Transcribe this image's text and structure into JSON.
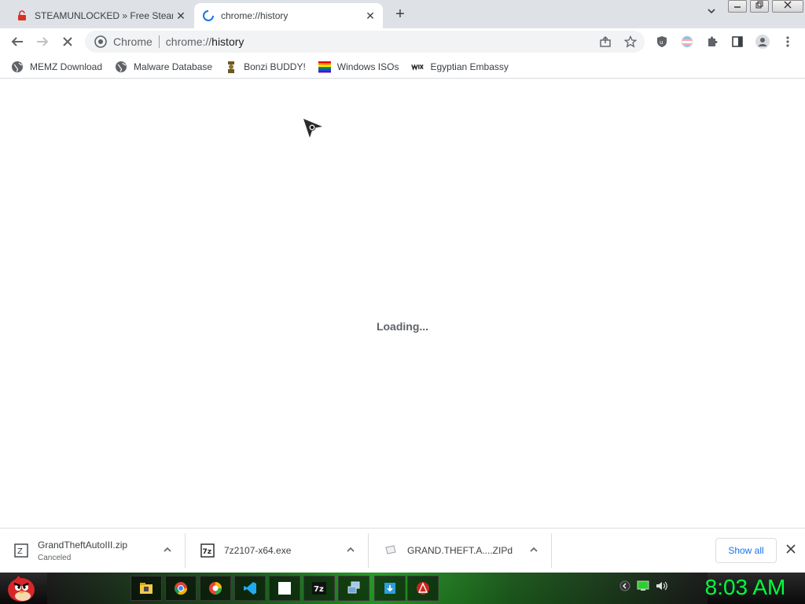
{
  "tabs": [
    {
      "title": "STEAMUNLOCKED » Free Steam",
      "icon": "lock-icon",
      "close": "✕"
    },
    {
      "title": "chrome://history",
      "icon": "loading-spinner-icon",
      "close": "✕"
    }
  ],
  "new_tab_label": "+",
  "toolbar": {
    "chip": "Chrome",
    "url_scheme": "chrome://",
    "url_host": "history"
  },
  "bookmarks": [
    {
      "label": "MEMZ Download",
      "icon": "globe-icon"
    },
    {
      "label": "Malware Database",
      "icon": "globe-icon"
    },
    {
      "label": "Bonzi BUDDY!",
      "icon": "bonzi-icon"
    },
    {
      "label": "Windows ISOs",
      "icon": "rainbow-flag-icon"
    },
    {
      "label": "Egyptian Embassy",
      "icon": "wix-icon"
    }
  ],
  "content": {
    "loading_text": "Loading..."
  },
  "downloads": [
    {
      "name": "GrandTheftAutoIII.zip",
      "status": "Canceled",
      "icon": "zip-file-icon"
    },
    {
      "name": "7z2107-x64.exe",
      "status": "",
      "icon": "7zip-icon"
    },
    {
      "name": "GRAND.THEFT.A....ZIPd",
      "status": "",
      "icon": "file-icon"
    }
  ],
  "show_all_label": "Show all",
  "taskbar": {
    "clock": "8:03 AM",
    "accent": "#00ff3c"
  }
}
